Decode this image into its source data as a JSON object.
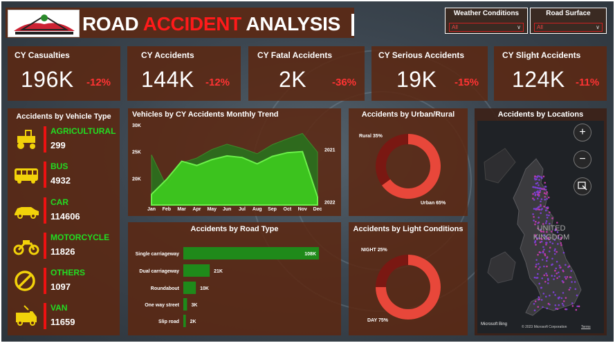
{
  "header": {
    "title_part1": "ROAD ",
    "title_part2": "ACCIDENT",
    "title_part3": " ANALYSIS"
  },
  "filters": [
    {
      "label": "Weather Conditions",
      "value": "All"
    },
    {
      "label": "Road Surface",
      "value": "All"
    }
  ],
  "kpis": [
    {
      "title": "CY Casualties",
      "value": "196K",
      "delta": "-12%"
    },
    {
      "title": "CY Accidents",
      "value": "144K",
      "delta": "-12%"
    },
    {
      "title": "CY Fatal Accidents",
      "value": "2K",
      "delta": "-36%"
    },
    {
      "title": "CY Serious Accidents",
      "value": "19K",
      "delta": "-15%"
    },
    {
      "title": "CY Slight Accidents",
      "value": "124K",
      "delta": "-11%"
    }
  ],
  "vehicle_panel": {
    "title": "Accidents by Vehicle Type",
    "items": [
      {
        "name": "AGRICULTURAL",
        "value": "299",
        "icon": "tractor-icon"
      },
      {
        "name": "BUS",
        "value": "4932",
        "icon": "bus-icon"
      },
      {
        "name": "CAR",
        "value": "114606",
        "icon": "car-icon"
      },
      {
        "name": "MOTORCYCLE",
        "value": "11826",
        "icon": "motorcycle-icon"
      },
      {
        "name": "OTHERS",
        "value": "1097",
        "icon": "prohibited-icon"
      },
      {
        "name": "VAN",
        "value": "11659",
        "icon": "van-icon"
      }
    ]
  },
  "chart_data": [
    {
      "type": "area",
      "title": "Vehicles by CY Accidents Monthly Trend",
      "x": [
        "Jan",
        "Feb",
        "Mar",
        "Apr",
        "May",
        "Jun",
        "Jul",
        "Aug",
        "Sep",
        "Oct",
        "Nov",
        "Dec"
      ],
      "yticks": [
        "30K",
        "25K",
        "20K"
      ],
      "ylim": [
        15000,
        30000
      ],
      "series": [
        {
          "name": "2021",
          "color": "#2c6e1e",
          "values": [
            24400,
            18500,
            22900,
            23800,
            25400,
            26400,
            25600,
            24600,
            26300,
            27400,
            28400,
            24900
          ]
        },
        {
          "name": "2022",
          "color": "#3ecb1e",
          "values": [
            17000,
            19800,
            23200,
            22400,
            23500,
            24200,
            23900,
            22700,
            24100,
            24800,
            25000,
            16500
          ]
        }
      ]
    },
    {
      "type": "pie",
      "title": "Accidents by Urban/Rural",
      "categories": [
        "Rural",
        "Urban"
      ],
      "values": [
        35,
        65
      ],
      "labels": [
        "Rural 35%",
        "Urban 65%"
      ],
      "colors": [
        "#7a1812",
        "#e8473a"
      ]
    },
    {
      "type": "bar",
      "title": "Accidents by Road Type",
      "categories": [
        "Single carriageway",
        "Dual carriageway",
        "Roundabout",
        "One way street",
        "Slip road"
      ],
      "values": [
        108,
        21,
        10,
        3,
        2
      ],
      "labels": [
        "108K",
        "21K",
        "10K",
        "3K",
        "2K"
      ],
      "color": "#1f8a1a"
    },
    {
      "type": "pie",
      "title": "Accidents by Light Conditions",
      "categories": [
        "NIGHT",
        "DAY"
      ],
      "values": [
        25,
        75
      ],
      "labels": [
        "NIGHT 25%",
        "DAY 75%"
      ],
      "colors": [
        "#7a1812",
        "#e8473a"
      ]
    }
  ],
  "map": {
    "title": "Accidents by Locations",
    "country_label": "UNITED KINGDOM",
    "zoom_in": "+",
    "zoom_out": "−",
    "attribution": "© 2023 Microsoft Corporation",
    "terms": "Terms",
    "brand": "Microsoft Bing"
  }
}
